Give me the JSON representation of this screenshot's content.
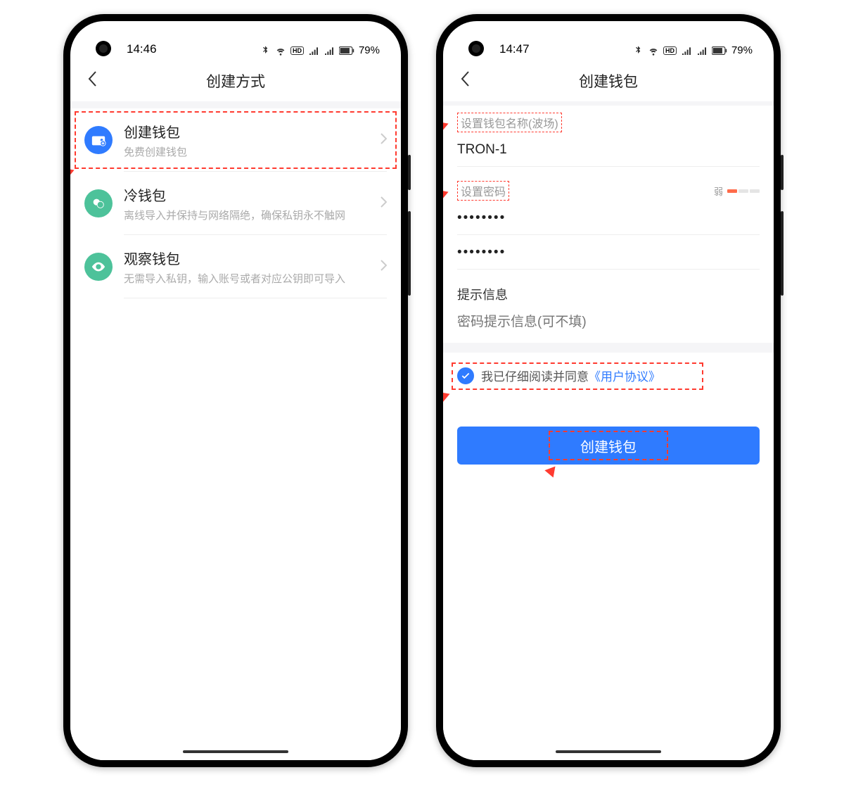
{
  "screen1": {
    "status": {
      "time": "14:46",
      "battery": "79%"
    },
    "title": "创建方式",
    "items": [
      {
        "title": "创建钱包",
        "sub": "免费创建钱包"
      },
      {
        "title": "冷钱包",
        "sub": "离线导入并保持与网络隔绝，确保私钥永不触网"
      },
      {
        "title": "观察钱包",
        "sub": "无需导入私钥，输入账号或者对应公钥即可导入"
      }
    ]
  },
  "screen2": {
    "status": {
      "time": "14:47",
      "battery": "79%"
    },
    "title": "创建钱包",
    "name_label": "设置钱包名称(波场)",
    "name_value": "TRON-1",
    "pwd_label": "设置密码",
    "strength_label": "弱",
    "hint_label": "提示信息",
    "hint_placeholder": "密码提示信息(可不填)",
    "agree_text": "我已仔细阅读并同意",
    "agree_link": "《用户协议》",
    "button_label": "创建钱包"
  }
}
